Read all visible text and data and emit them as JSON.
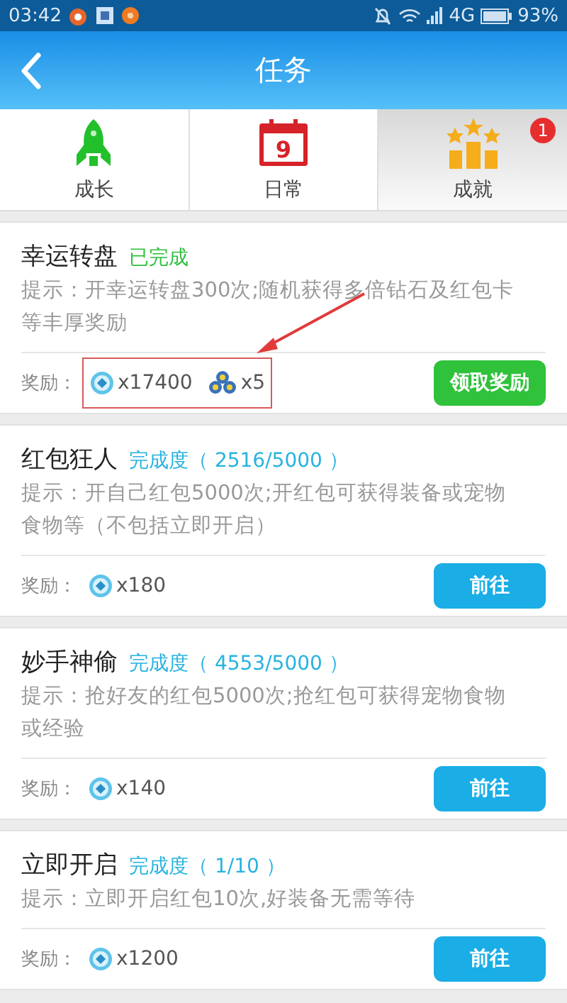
{
  "status_bar": {
    "time": "03:42",
    "network": "4G",
    "battery": "93%"
  },
  "header": {
    "title": "任务"
  },
  "tabs": [
    {
      "label": "成长",
      "kind": "rocket",
      "selected": false
    },
    {
      "label": "日常",
      "kind": "calendar",
      "calendar_day": "9",
      "selected": false
    },
    {
      "label": "成就",
      "kind": "podium",
      "selected": true,
      "badge": "1"
    }
  ],
  "tasks": [
    {
      "title": "幸运转盘",
      "kind": "completed",
      "status": "已完成",
      "hint": "提示：开幸运转盘300次;随机获得多倍钻石及红包卡等丰厚奖励",
      "reward_label": "奖励：",
      "rewards": [
        {
          "kind": "coin",
          "amount": "x17400"
        },
        {
          "kind": "gem",
          "amount": "x5"
        }
      ],
      "button": {
        "kind": "claim",
        "label": "领取奖励"
      },
      "annotated": true
    },
    {
      "title": "红包狂人",
      "kind": "progress",
      "status": "完成度（ 2516/5000 ）",
      "hint": "提示：开自己红包5000次;开红包可获得装备或宠物食物等（不包括立即开启）",
      "reward_label": "奖励：",
      "rewards": [
        {
          "kind": "coin",
          "amount": "x180"
        }
      ],
      "button": {
        "kind": "go",
        "label": "前往"
      },
      "annotated": false
    },
    {
      "title": "妙手神偷",
      "kind": "progress",
      "status": "完成度（ 4553/5000 ）",
      "hint": "提示：抢好友的红包5000次;抢红包可获得宠物食物或经验",
      "reward_label": "奖励：",
      "rewards": [
        {
          "kind": "coin",
          "amount": "x140"
        }
      ],
      "button": {
        "kind": "go",
        "label": "前往"
      },
      "annotated": false
    },
    {
      "title": "立即开启",
      "kind": "progress",
      "status": "完成度（ 1/10 ）",
      "hint": "提示：立即开启红包10次,好装备无需等待",
      "reward_label": "奖励：",
      "rewards": [
        {
          "kind": "coin",
          "amount": "x1200"
        }
      ],
      "button": {
        "kind": "go",
        "label": "前往"
      },
      "annotated": false
    }
  ]
}
